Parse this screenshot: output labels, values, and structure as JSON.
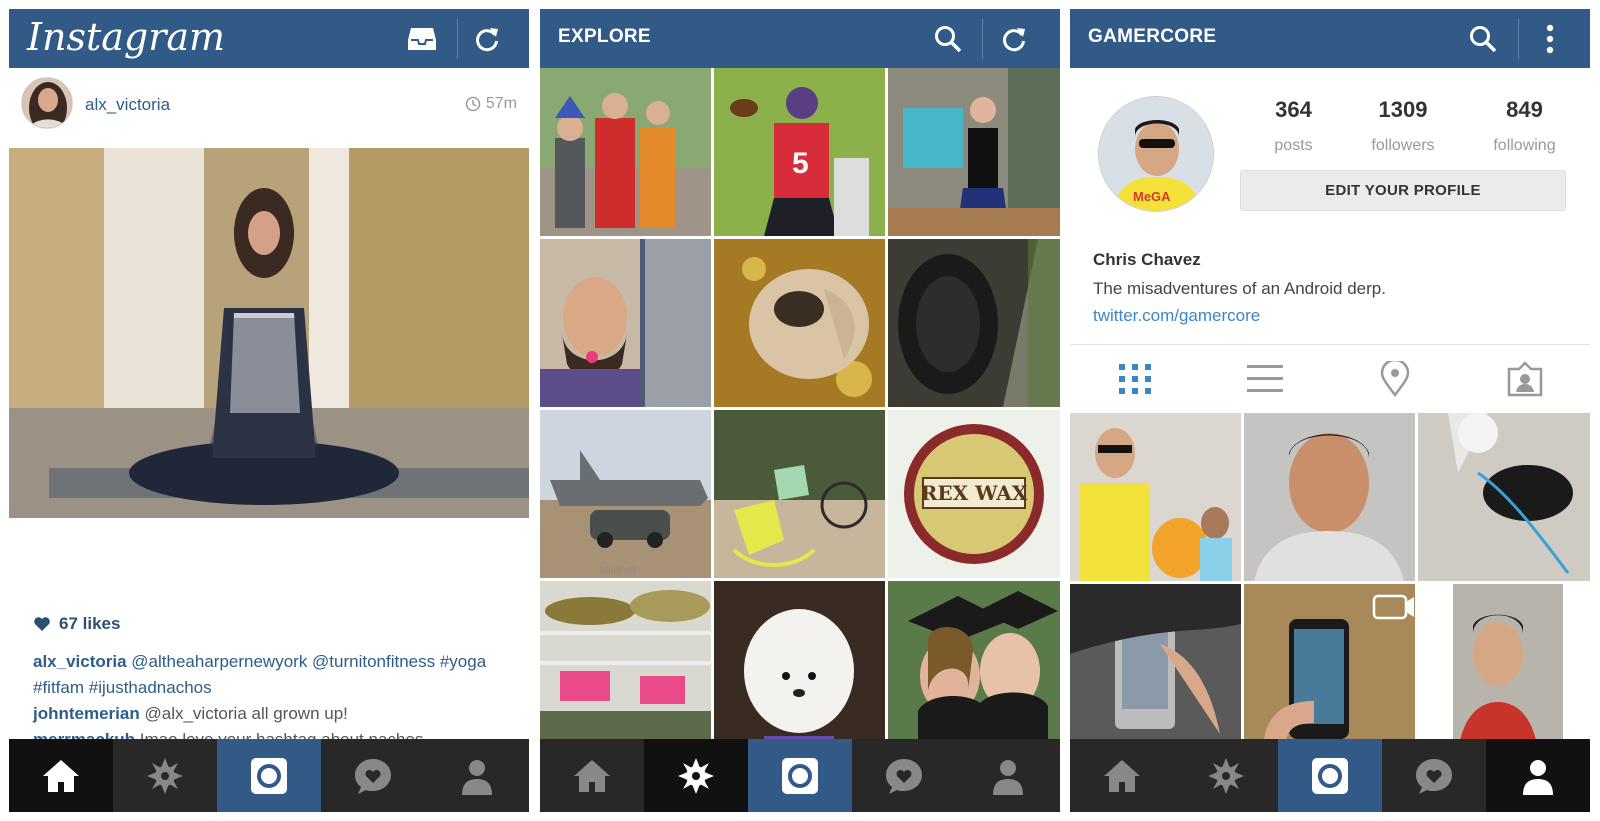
{
  "feed": {
    "logo": "Instagram",
    "post": {
      "username": "alx_victoria",
      "time": "57m",
      "likes": "67 likes",
      "comments": [
        {
          "user": "alx_victoria",
          "text": "@altheaharpernewyork @turnitonfitness #yoga #fitfam #ijusthadnachos"
        },
        {
          "user": "johntemerian",
          "text": "@alx_victoria all grown up!"
        },
        {
          "user": "merrmackub",
          "text": "Imao love your hashtag about nachos"
        }
      ]
    }
  },
  "explore": {
    "title": "EXPLORE",
    "photos": [
      "kids-group",
      "football-player",
      "woman-dress",
      "man-lollipop",
      "dog-blanket",
      "tire",
      "airplane-car",
      "garden-chairs",
      "rex-wax-tin",
      "fridge",
      "white-puppy",
      "graduates"
    ],
    "overlay_texts": {
      "rex_wax": "REX WAX",
      "minifett": "MiniFett"
    }
  },
  "profile": {
    "title": "GAMERCORE",
    "stats": [
      {
        "value": "364",
        "label": "posts"
      },
      {
        "value": "1309",
        "label": "followers"
      },
      {
        "value": "849",
        "label": "following"
      }
    ],
    "edit_button": "EDIT YOUR PROFILE",
    "name": "Chris Chavez",
    "bio": "The misadventures of an Android derp.",
    "link": "twitter.com/gamercore",
    "tabs": [
      "grid-icon",
      "list-icon",
      "location-pin-icon",
      "tagged-icon"
    ],
    "photos": [
      "man-with-jake",
      "selfie-bed",
      "dog-leash",
      "htc-phone",
      "samsung-phone",
      "man-car"
    ]
  },
  "bottom_nav": [
    "home-icon",
    "explore-icon",
    "camera-icon",
    "activity-icon",
    "profile-icon"
  ],
  "colors": {
    "bar": "#325a86",
    "nav": "#282828",
    "nav_active": "#111111",
    "link": "#3d86c6"
  }
}
